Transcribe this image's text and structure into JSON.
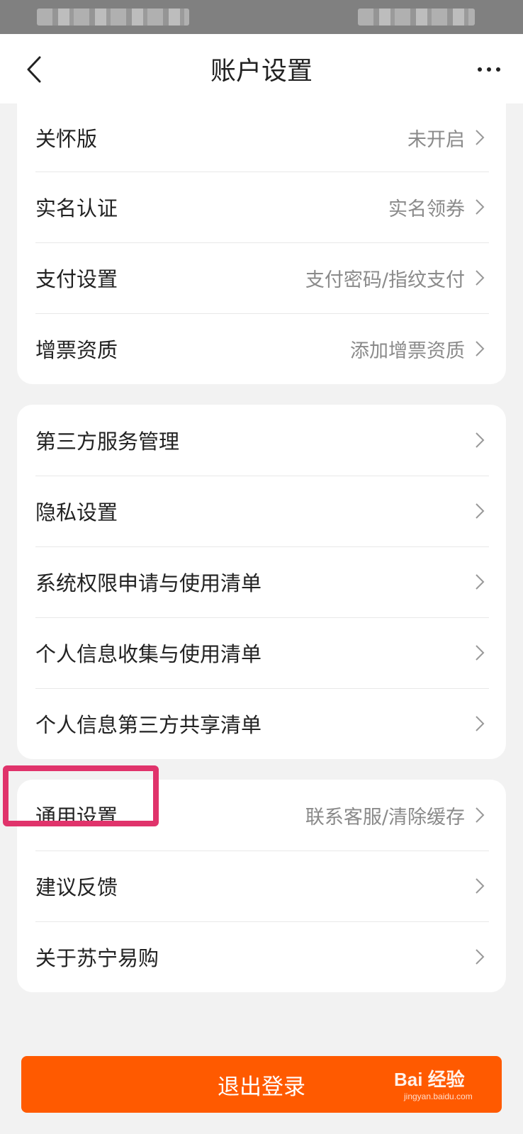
{
  "header": {
    "title": "账户设置"
  },
  "groups": [
    {
      "items": [
        {
          "label": "关怀版",
          "value": "未开启"
        },
        {
          "label": "实名认证",
          "value": "实名领券"
        },
        {
          "label": "支付设置",
          "value": "支付密码/指纹支付"
        },
        {
          "label": "增票资质",
          "value": "添加增票资质"
        }
      ]
    },
    {
      "items": [
        {
          "label": "第三方服务管理",
          "value": ""
        },
        {
          "label": "隐私设置",
          "value": ""
        },
        {
          "label": "系统权限申请与使用清单",
          "value": ""
        },
        {
          "label": "个人信息收集与使用清单",
          "value": ""
        },
        {
          "label": "个人信息第三方共享清单",
          "value": ""
        }
      ]
    },
    {
      "items": [
        {
          "label": "通用设置",
          "value": "联系客服/清除缓存"
        },
        {
          "label": "建议反馈",
          "value": ""
        },
        {
          "label": "关于苏宁易购",
          "value": ""
        }
      ]
    }
  ],
  "logout": {
    "label": "退出登录"
  },
  "watermark": {
    "main": "Bai 经验",
    "sub": "jingyan.baidu.com"
  },
  "icons": {
    "back": "back-arrow-icon",
    "more": "more-dots-icon",
    "row": "chevron-right-icon"
  },
  "colors": {
    "accent": "#ff5a00",
    "highlight": "#e0336b",
    "background": "#f2f2f2"
  }
}
